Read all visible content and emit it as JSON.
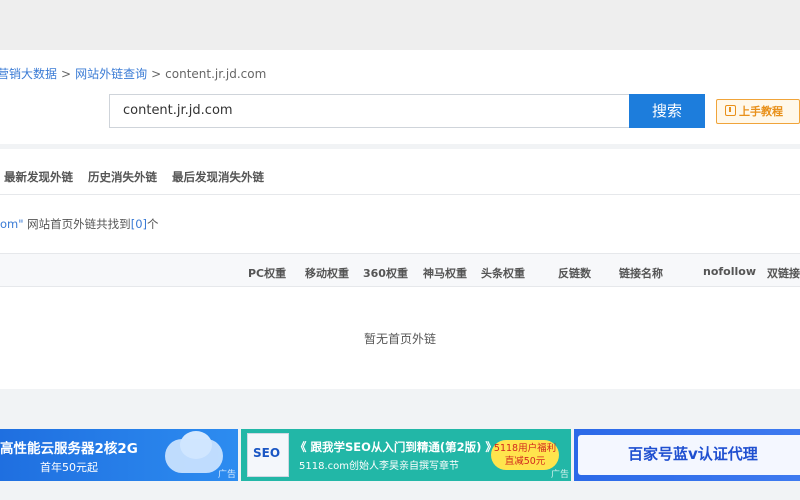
{
  "breadcrumb": {
    "item1": "营销大数据",
    "item2": "网站外链查询",
    "current": "content.jr.jd.com",
    "separator": ">"
  },
  "search": {
    "value": "content.jr.jd.com",
    "button_label": "搜索"
  },
  "tutorial": {
    "label": "上手教程",
    "icon": "tutorial-icon"
  },
  "tabs": [
    "最新发现外链",
    "历史消失外链",
    "最后发现消失外链"
  ],
  "summary": {
    "prefix": "om\"",
    "text": " 网站首页外链共找到",
    "lbracket": "[",
    "count": "0",
    "rbracket": "]",
    "suffix": "个"
  },
  "table": {
    "headers": [
      "PC权重",
      "移动权重",
      "360权重",
      "神马权重",
      "头条权重",
      "反链数",
      "链接名称",
      "nofollow",
      "双链接"
    ],
    "empty_text": "暂无首页外链"
  },
  "ads": {
    "banner1": {
      "line1": "高性能云服务器2核2G",
      "line2": "首年50元起",
      "tag": "广告"
    },
    "banner2": {
      "line1": "《 跟我学SEO从入门到精通(第2版) 》",
      "line2": "5118.com创始人李昊亲自撰写章节",
      "pill": "5118用户福利 直减50元",
      "book": "SEO",
      "tag": "广告"
    },
    "banner3": {
      "line1": "百家号蓝v认证代理"
    }
  },
  "colors": {
    "accent": "#1d7ddc",
    "link": "#3a7bd5",
    "warning": "#e8901a"
  }
}
